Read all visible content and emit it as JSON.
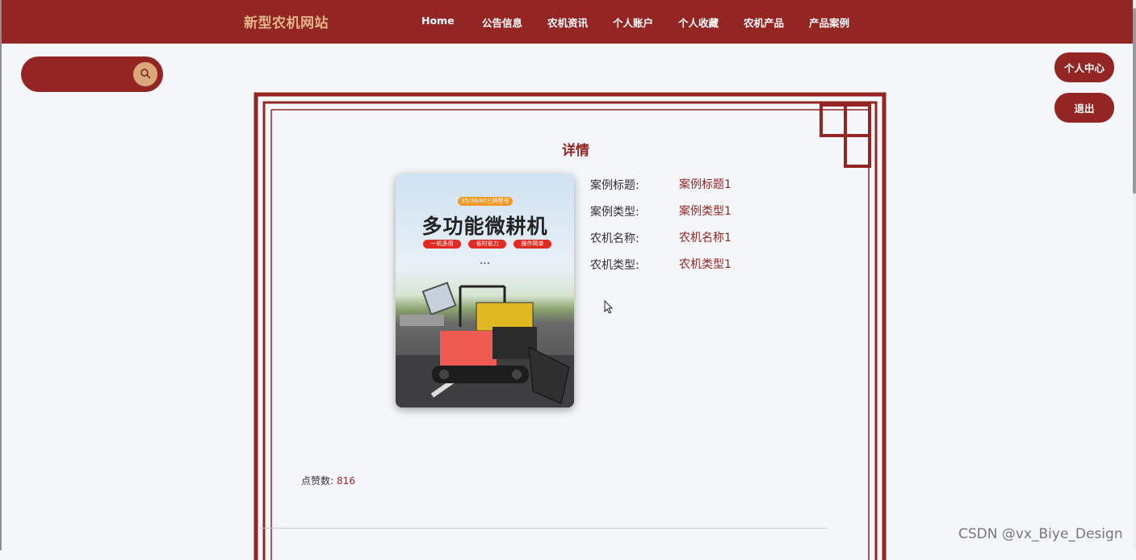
{
  "nav": {
    "brand": "新型农机网站",
    "items": [
      "Home",
      "公告信息",
      "农机资讯",
      "个人账户",
      "个人收藏",
      "农机产品",
      "产品案例"
    ]
  },
  "search": {
    "placeholder": "",
    "icon": "search-icon"
  },
  "side": {
    "profile_label": "个人中心",
    "logout_label": "退出"
  },
  "detail": {
    "title": "详情",
    "fields": [
      {
        "label": "案例标题:",
        "value": "案例标题1"
      },
      {
        "label": "案例类型:",
        "value": "案例类型1"
      },
      {
        "label": "农机名称:",
        "value": "农机名称1"
      },
      {
        "label": "农机类型:",
        "value": "农机类型1"
      }
    ],
    "likes_label": "点赞数:",
    "likes_value": "816"
  },
  "poster": {
    "tag": "35/36/40三种型号",
    "headline": "多功能微耕机",
    "pills": [
      "一机多用",
      "省时省力",
      "操作简单"
    ],
    "dots": "..."
  },
  "watermark": "CSDN @vx_Biye_Design",
  "colors": {
    "primary": "#932623",
    "accent": "#dca77b",
    "brand_text": "#e4b48a",
    "background": "#f4f6f9"
  }
}
